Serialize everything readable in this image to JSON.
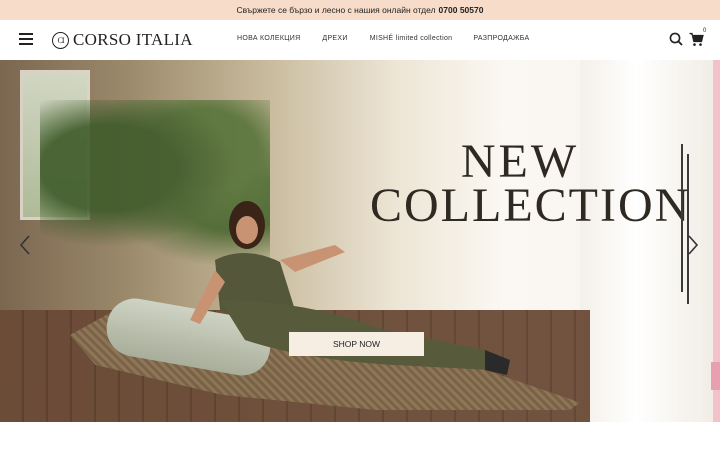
{
  "topbar": {
    "text": "Свържете се бързо и лесно с нашия онлайн отдел",
    "phone": "0700 50570"
  },
  "header": {
    "logo_mark": "CI",
    "logo_text": "CORSO ITALIA",
    "nav": [
      {
        "label": "НОВА КОЛЕКЦИЯ"
      },
      {
        "label": "ДРЕХИ"
      },
      {
        "label": "MISHÉ limited collection"
      },
      {
        "label": "РАЗПРОДАЖБА"
      }
    ],
    "cart_count": "0",
    "icons": [
      "menu-icon",
      "search-icon",
      "cart-icon"
    ]
  },
  "hero": {
    "headline_line1": "NEW",
    "headline_line2": "COLLECTION",
    "cta_label": "SHOP NOW",
    "icons": [
      "chevron-left-icon",
      "chevron-right-icon"
    ]
  },
  "colors": {
    "topbar_bg": "#f7dcc9",
    "cta_bg": "#f6ede3",
    "side_tab": "#e9a0ae"
  }
}
